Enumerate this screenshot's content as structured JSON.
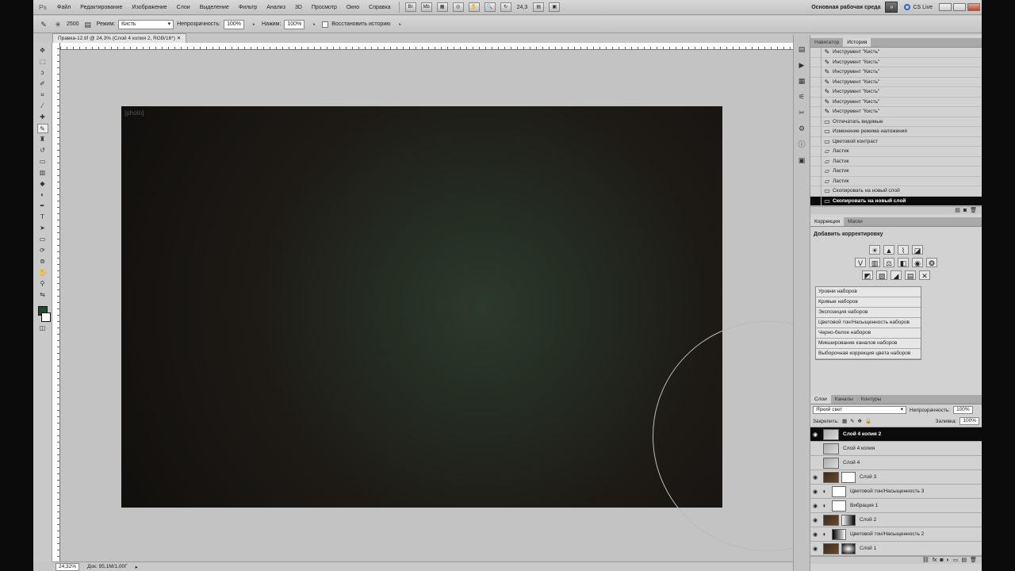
{
  "menubar": {
    "logo": "Ps",
    "items": [
      "Файл",
      "Редактирование",
      "Изображение",
      "Слои",
      "Выделение",
      "Фильтр",
      "Анализ",
      "3D",
      "Просмотр",
      "Окно",
      "Справка"
    ],
    "zoom": "24,3",
    "workspace": "Основная рабочая среда",
    "arrow": "»",
    "cs_live": "CS Live"
  },
  "options": {
    "brush_size": "2500",
    "mode_label": "Режим:",
    "mode_value": "Кисть",
    "opacity_label": "Непрозрачность:",
    "opacity_value": "100%",
    "pressure_label": "Нажим:",
    "pressure_value": "100%",
    "restore_label": "Восстановить историю"
  },
  "document": {
    "tab_title": "Правка-12.tif @ 24,3% (Слой 4 копия 2, RGB/16*)",
    "image_placeholder": "[photo]"
  },
  "status": {
    "zoom": "24,32%",
    "doc_info": "Док: 95,1M/1,00Г"
  },
  "panels": {
    "history_tabs": [
      "Навигатор",
      "История"
    ],
    "history_items": [
      "Инструмент \"Кисть\"",
      "Инструмент \"Кисть\"",
      "Инструмент \"Кисть\"",
      "Инструмент \"Кисть\"",
      "Инструмент \"Кисть\"",
      "Инструмент \"Кисть\"",
      "Инструмент \"Кисть\"",
      "Отпечатать видимые",
      "Изменение режима наложения",
      "Цветовой контраст",
      "Ластик",
      "Ластик",
      "Ластик",
      "Ластик",
      "Скопировать на новый слой",
      "Скопировать на новый слой"
    ],
    "adjust_tabs": [
      "Коррекция",
      "Маски"
    ],
    "adjust_title": "Добавить корректировку",
    "adjust_presets": [
      "Уровни наборов",
      "Кривые наборов",
      "Экспозиция наборов",
      "Цветовой тон/Насыщенность наборов",
      "Черно-белое наборов",
      "Микширование каналов наборов",
      "Выборочная коррекция цвета наборов"
    ],
    "layer_tabs": [
      "Слои",
      "Каналы",
      "Контуры"
    ],
    "blend_mode": "Яркий свет",
    "layer_opacity_label": "Непрозрачность:",
    "layer_opacity": "100%",
    "lock_label": "Закрепить:",
    "fill_label": "Заливка:",
    "fill_value": "100%",
    "layers": [
      {
        "name": "Слой 4 копия 2",
        "selected": true
      },
      {
        "name": "Слой 4 копия"
      },
      {
        "name": "Слой 4"
      },
      {
        "name": "Слой 3"
      },
      {
        "name": "Цветовой тон/Насыщенность 3"
      },
      {
        "name": "Вибрация 1"
      },
      {
        "name": "Слой 2"
      },
      {
        "name": "Цветовой тон/Насыщенность 2"
      },
      {
        "name": "Слой 1"
      }
    ]
  },
  "icons": {
    "brush": "brush-icon",
    "eye": "eye-icon",
    "history_state": "history-state-icon"
  }
}
